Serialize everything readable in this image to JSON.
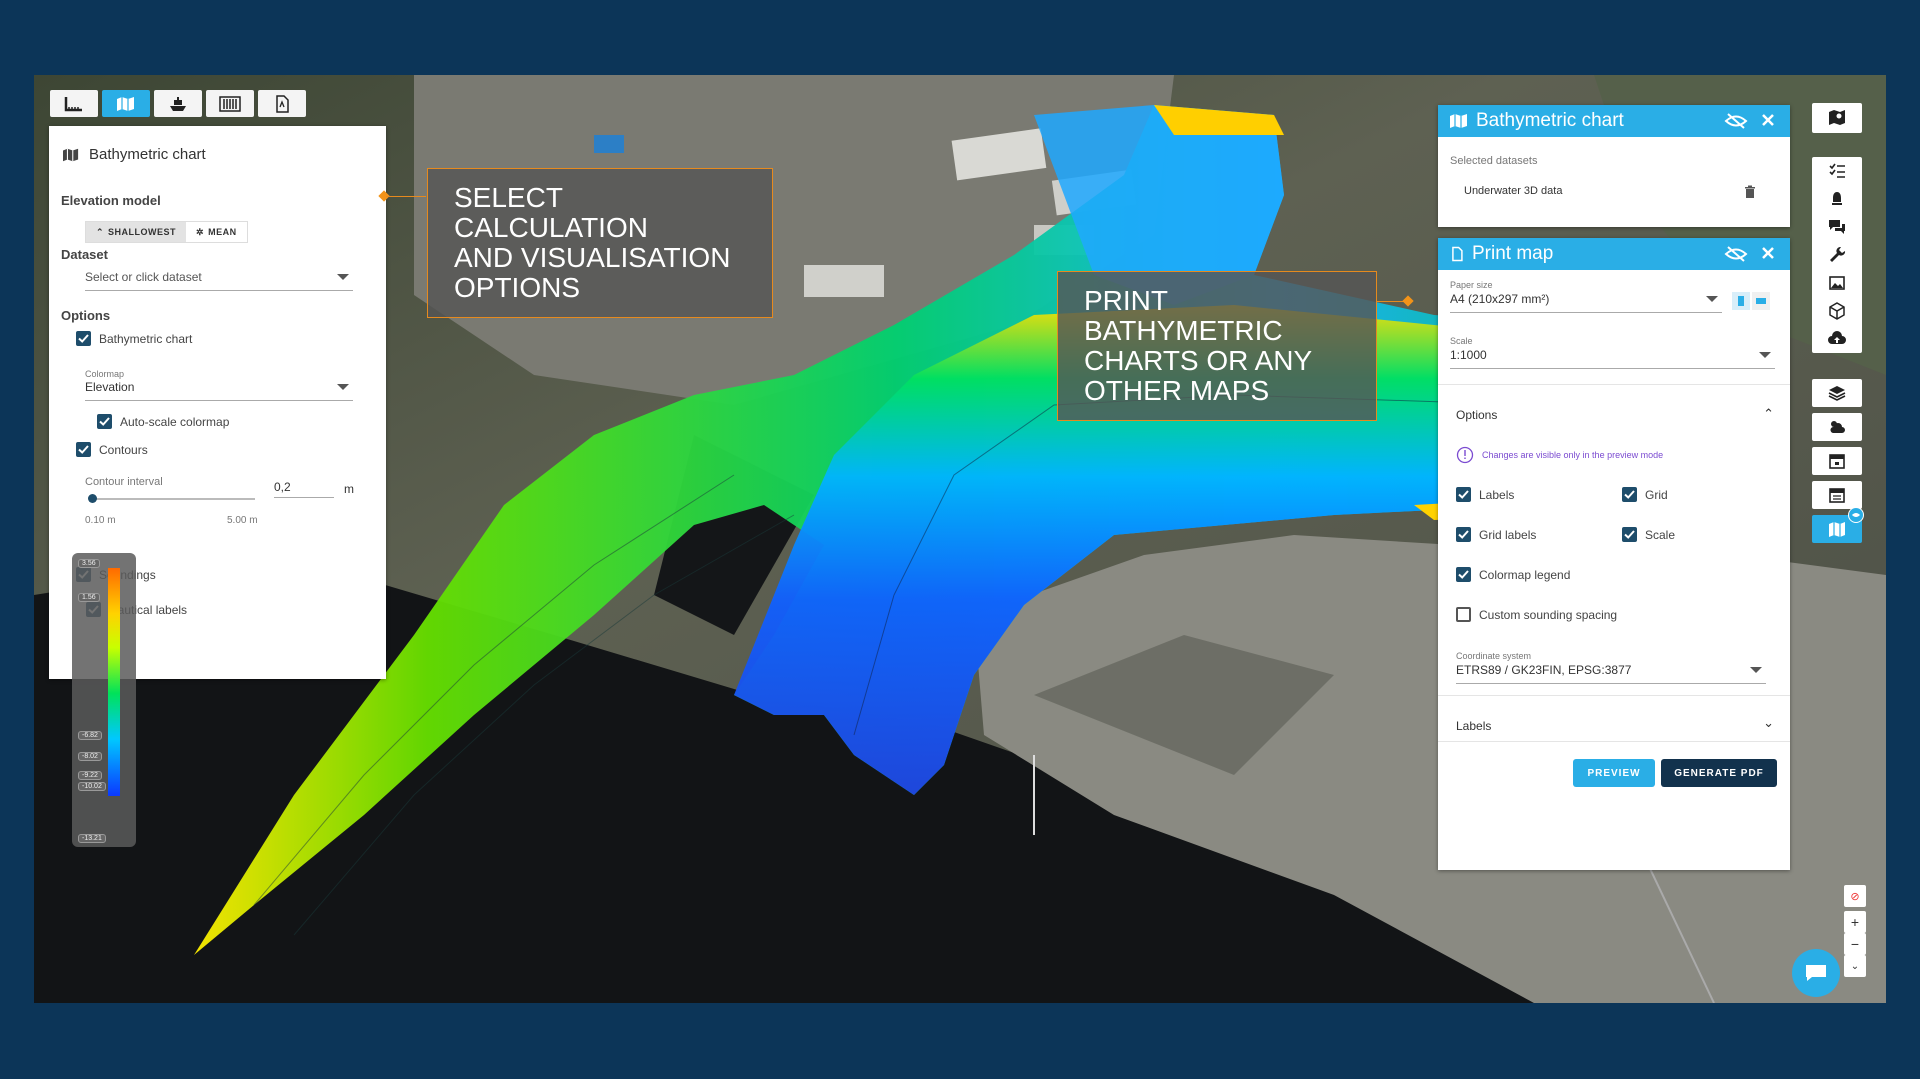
{
  "toolbar": {
    "buttons": [
      {
        "icon": "measure-icon",
        "active": false
      },
      {
        "icon": "map-icon",
        "active": true
      },
      {
        "icon": "ship-icon",
        "active": false
      },
      {
        "icon": "barcode-icon",
        "active": false
      },
      {
        "icon": "pdf-icon",
        "active": false
      }
    ]
  },
  "left_panel": {
    "title": "Bathymetric chart",
    "elevation_model_label": "Elevation model",
    "shallowest_label": "SHALLOWEST",
    "mean_label": "MEAN",
    "dataset_label": "Dataset",
    "dataset_placeholder": "Select or click dataset",
    "options_label": "Options",
    "bathy_chart_label": "Bathymetric chart",
    "colormap_label": "Colormap",
    "colormap_value": "Elevation",
    "autoscale_label": "Auto-scale colormap",
    "contours_label": "Contours",
    "contour_interval_label": "Contour interval",
    "contour_interval_value": "0,2",
    "contour_unit": "m",
    "slider_min": "0.10 m",
    "slider_max": "5.00 m",
    "slider_fraction": 0.02,
    "soundings_label": "Soundings",
    "nautical_labels_label": "Nautical labels"
  },
  "legend": {
    "values": [
      "3.56",
      "1.56",
      "-6.82",
      "-8.02",
      "-9.22",
      "-10.02",
      "-13.21"
    ]
  },
  "callouts": {
    "left": [
      "SELECT CALCULATION",
      "AND VISUALISATION",
      "OPTIONS"
    ],
    "right": [
      "PRINT BATHYMETRIC",
      "CHARTS OR ANY",
      "OTHER MAPS"
    ]
  },
  "bathy_panel": {
    "title": "Bathymetric chart",
    "selected_datasets_label": "Selected datasets",
    "dataset_name": "Underwater 3D data"
  },
  "print_panel": {
    "title": "Print map",
    "paper_size_label": "Paper size",
    "paper_size_value": "A4 (210x297 mm²)",
    "scale_label": "Scale",
    "scale_value": "1:1000",
    "options_label": "Options",
    "notice": "Changes are visible only in the preview mode",
    "labels_label": "Labels",
    "grid_label": "Grid",
    "grid_labels_label": "Grid labels",
    "scale_cb_label": "Scale",
    "colormap_legend_label": "Colormap legend",
    "custom_sounding_label": "Custom sounding spacing",
    "coord_system_label": "Coordinate system",
    "coord_system_value": "ETRS89 / GK23FIN, EPSG:3877",
    "labels_section": "Labels",
    "preview_label": "PREVIEW",
    "generate_label": "GENERATE PDF"
  },
  "colors": {
    "accent": "#2aaee6",
    "dark": "#1e4d6b",
    "callout_border": "#e68a1e",
    "frame": "#0c3558",
    "notice": "#7b4bd1"
  },
  "zoom": {
    "plus": "+",
    "minus": "−"
  }
}
